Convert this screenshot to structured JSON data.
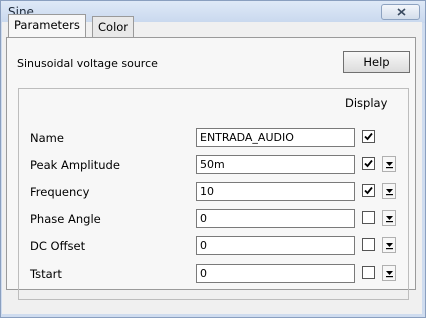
{
  "window": {
    "title": "Sine"
  },
  "tabs": [
    {
      "label": "Parameters",
      "active": true
    },
    {
      "label": "Color",
      "active": false
    }
  ],
  "panel": {
    "description": "Sinusoidal voltage source",
    "help_label": "Help",
    "display_header": "Display"
  },
  "params": [
    {
      "label": "Name",
      "value": "ENTRADA_AUDIO",
      "display": true,
      "has_dropdown": false
    },
    {
      "label": "Peak Amplitude",
      "value": "50m",
      "display": true,
      "has_dropdown": true
    },
    {
      "label": "Frequency",
      "value": "10",
      "display": true,
      "has_dropdown": true
    },
    {
      "label": "Phase Angle",
      "value": "0",
      "display": false,
      "has_dropdown": true
    },
    {
      "label": "DC Offset",
      "value": "0",
      "display": false,
      "has_dropdown": true
    },
    {
      "label": "Tstart",
      "value": "0",
      "display": false,
      "has_dropdown": true
    }
  ]
}
